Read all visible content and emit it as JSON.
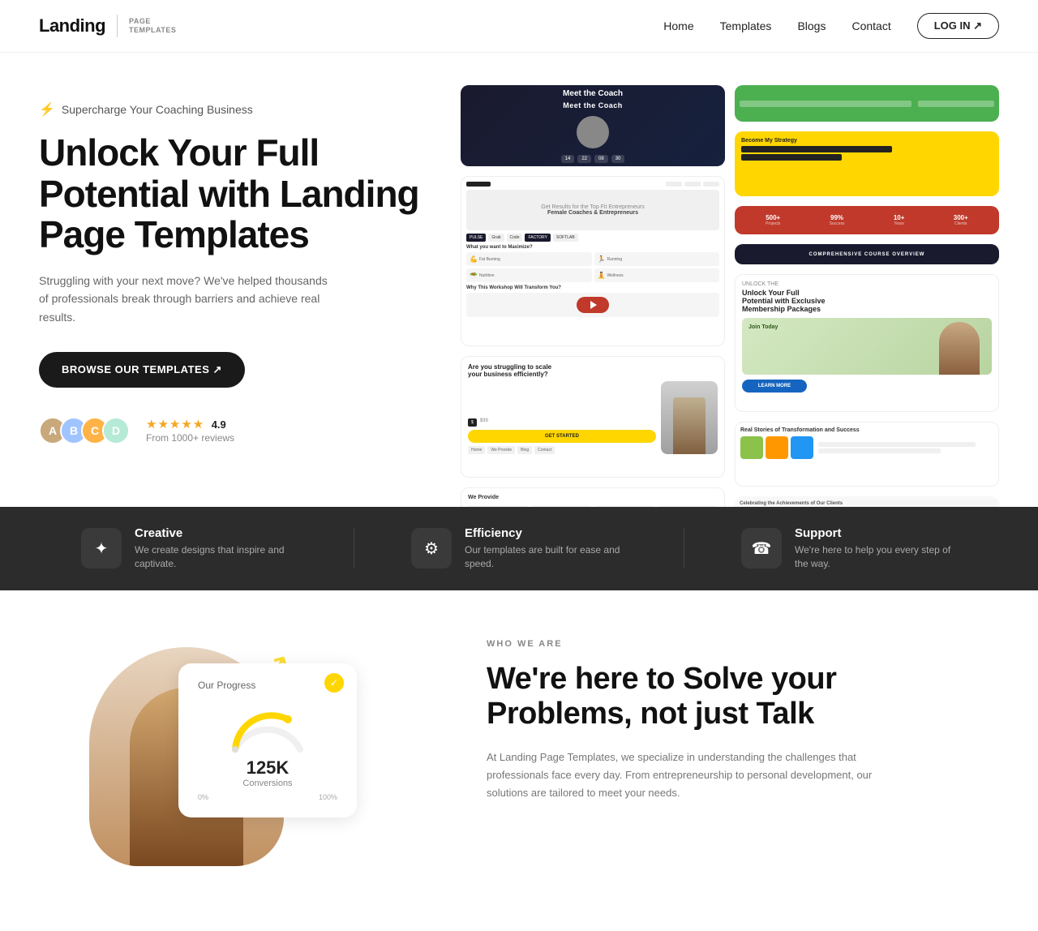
{
  "header": {
    "logo_main": "Landing",
    "logo_sub": "PAGE\nTEMPLATES",
    "nav_items": [
      "Home",
      "Templates",
      "Blogs",
      "Contact"
    ],
    "login_label": "LOG IN ↗"
  },
  "hero": {
    "badge_text": "Supercharge Your Coaching Business",
    "title": "Unlock Your Full Potential with Landing Page Templates",
    "description": "Struggling with your next move? We've helped thousands of professionals break through barriers and achieve real results.",
    "cta_label": "BROWSE OUR TEMPLATES ↗",
    "rating": "4.9",
    "review_count": "From 1000+ reviews"
  },
  "features": [
    {
      "icon": "✦",
      "title": "Creative",
      "desc": "We create designs that inspire and captivate."
    },
    {
      "icon": "⚙",
      "title": "Efficiency",
      "desc": "Our templates are built for ease and speed."
    },
    {
      "icon": "☎",
      "title": "Support",
      "desc": "We're here to help you every step of the way."
    }
  ],
  "who": {
    "label": "WHO WE ARE",
    "title": "We're here to Solve your Problems, not just Talk",
    "description": "At Landing Page Templates, we specialize in understanding the challenges that professionals face every day. From entrepreneurship to personal development, our solutions are tailored to meet your needs.",
    "progress_title": "Our Progress",
    "progress_num": "125K",
    "progress_label": "Conversions",
    "progress_percent_start": "0%",
    "progress_percent_end": "100%"
  }
}
